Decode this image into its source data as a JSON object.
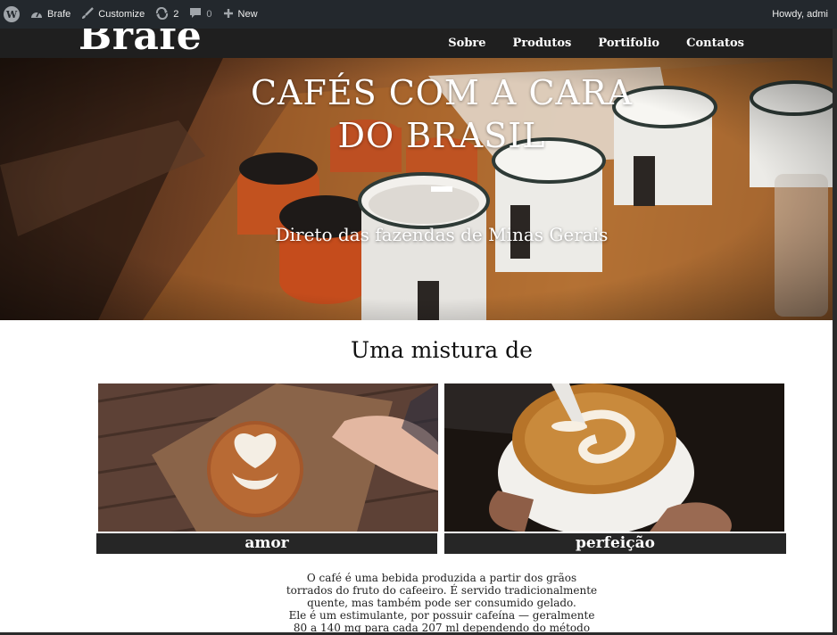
{
  "admin_bar": {
    "site_name": "Brafe",
    "customize": "Customize",
    "updates_count": "2",
    "comments_count": "0",
    "new_label": "New",
    "howdy": "Howdy, admi",
    "icons": [
      "wordpress-logo-icon",
      "dashboard-icon",
      "brush-icon",
      "refresh-icon",
      "comment-icon",
      "plus-icon"
    ]
  },
  "header": {
    "site_title": "Brafe",
    "nav": [
      "Sobre",
      "Produtos",
      "Portifolio",
      "Contatos"
    ]
  },
  "hero": {
    "title_line1": "CAFÉS COM A CARA",
    "title_line2": "DO BRASIL",
    "subtitle": "Direto das fazendas de Minas Gerais"
  },
  "section": {
    "title": "Uma mistura de",
    "cards": [
      {
        "label": "amor"
      },
      {
        "label": "perfeição"
      }
    ],
    "description": [
      "O café é uma bebida produzida a partir dos grãos",
      "torrados do fruto do cafeeiro. É servido tradicionalmente",
      "quente, mas também pode ser consumido gelado.",
      "Ele é um estimulante, por possuir cafeína — geralmente",
      "80 a 140 mg para cada 207 ml dependendo do método"
    ]
  },
  "colors": {
    "admin_bar_bg": "#23282d",
    "header_bg": "#1f1f1f",
    "label_bg": "#262626"
  }
}
